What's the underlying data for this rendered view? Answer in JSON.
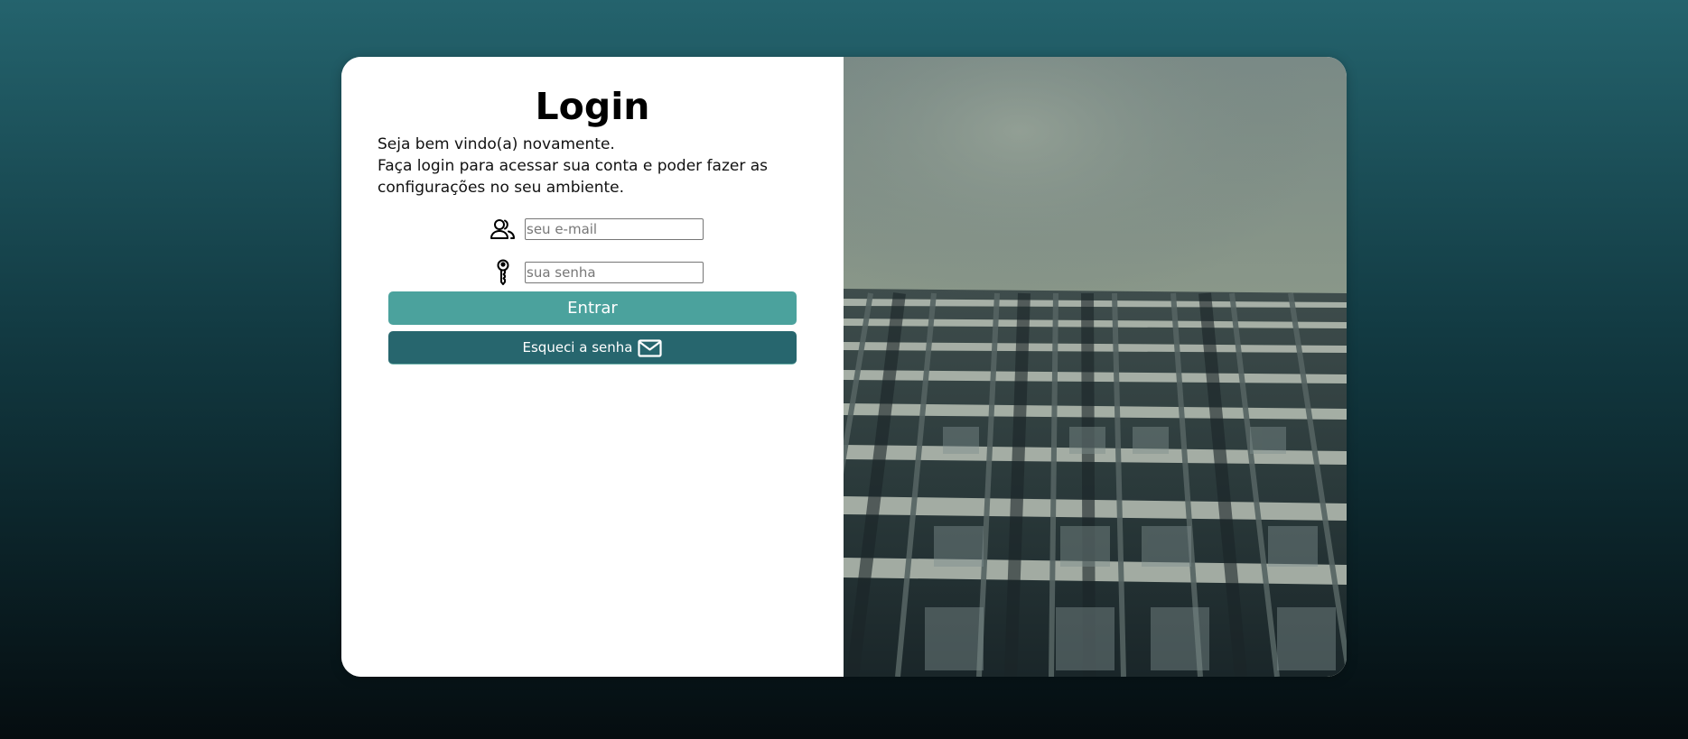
{
  "login": {
    "title": "Login",
    "intro_line1": "Seja bem vindo(a) novamente.",
    "intro_line2": "Faça login para acessar sua conta e poder fazer as configurações no seu ambiente.",
    "email": {
      "icon": "users-icon",
      "placeholder": "seu e-mail",
      "value": ""
    },
    "password": {
      "icon": "key-icon",
      "placeholder": "sua senha",
      "value": ""
    },
    "submit_label": "Entrar",
    "forgot_label": "Esqueci a senha",
    "forgot_icon": "mail-icon"
  },
  "hero_image": {
    "subject": "building-facade-photo"
  },
  "colors": {
    "primary_button": "#4ba29d",
    "secondary_button": "#27666e",
    "background_top": "#24636d",
    "background_bottom": "#050d10"
  }
}
